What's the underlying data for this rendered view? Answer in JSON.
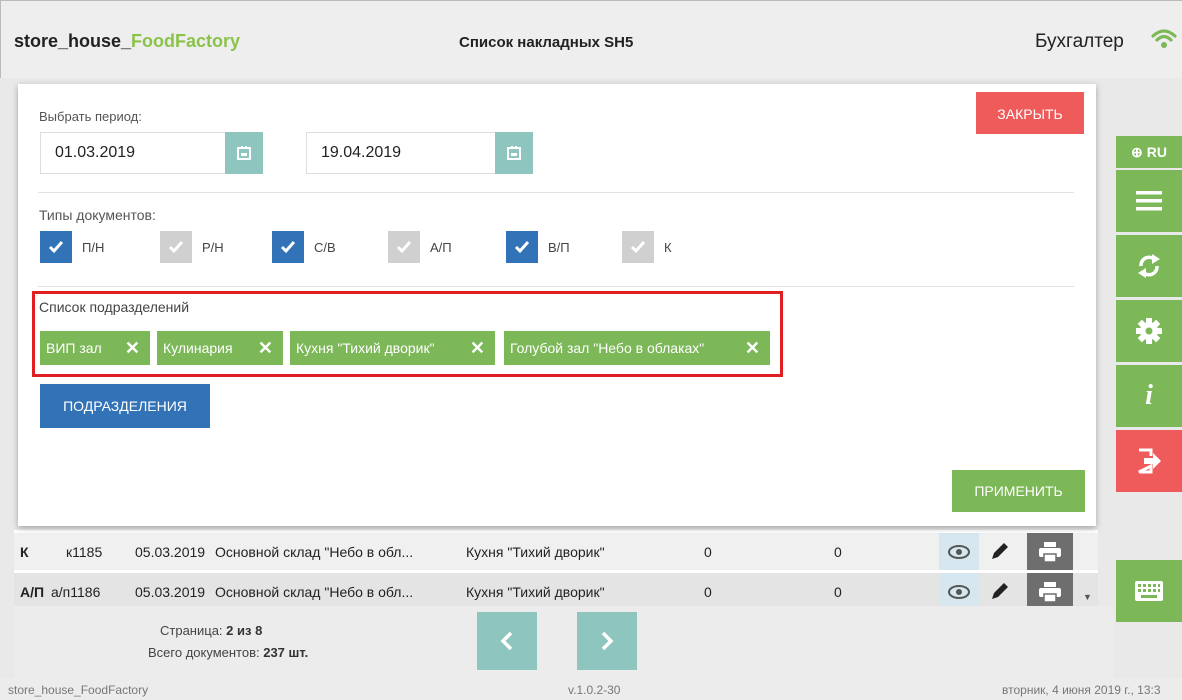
{
  "header": {
    "app_name_prefix": "store_house_",
    "app_name_accent": "FoodFactory",
    "page_title": "Список накладных SH5",
    "user_role": "Бухгалтер"
  },
  "panel": {
    "period_label": "Выбрать период:",
    "date_from": "01.03.2019",
    "date_to": "19.04.2019",
    "close_label": "ЗАКРЫТЬ",
    "doc_types_label": "Типы документов:",
    "doc_types": [
      {
        "label": "П/Н",
        "checked": true
      },
      {
        "label": "Р/Н",
        "checked": false
      },
      {
        "label": "С/В",
        "checked": true
      },
      {
        "label": "А/П",
        "checked": false
      },
      {
        "label": "В/П",
        "checked": true
      },
      {
        "label": "К",
        "checked": false
      }
    ],
    "departments_label": "Список подразделений",
    "departments": [
      "ВИП зал",
      "Кулинария",
      "Кухня \"Тихий дворик\"",
      "Голубой зал \"Небо в облаках\""
    ],
    "departments_button": "ПОДРАЗДЕЛЕНИЯ",
    "apply_label": "ПРИМЕНИТЬ"
  },
  "table": {
    "rows": [
      {
        "type": "К",
        "number": "к1185",
        "date": "05.03.2019",
        "from": "Основной склад \"Небо в обл...",
        "to": "Кухня \"Тихий дворик\"",
        "v1": "0",
        "v2": "0"
      },
      {
        "type": "А/П",
        "number": "а/п1186",
        "date": "05.03.2019",
        "from": "Основной склад \"Небо в обл...",
        "to": "Кухня \"Тихий дворик\"",
        "v1": "0",
        "v2": "0"
      }
    ]
  },
  "pager": {
    "page_prefix": "Страница: ",
    "page_value": "2 из 8",
    "total_prefix": "Всего документов: ",
    "total_value": "237 шт."
  },
  "rightbar": {
    "lang": "RU"
  },
  "footer": {
    "app": "store_house_FoodFactory",
    "version": "v.1.0.2-30",
    "datetime": "вторник, 4 июня 2019 г., 13:3"
  },
  "colors": {
    "green": "#7cb758",
    "red": "#ef5b5b",
    "blue": "#3273b8",
    "teal": "#8ec6bf"
  }
}
